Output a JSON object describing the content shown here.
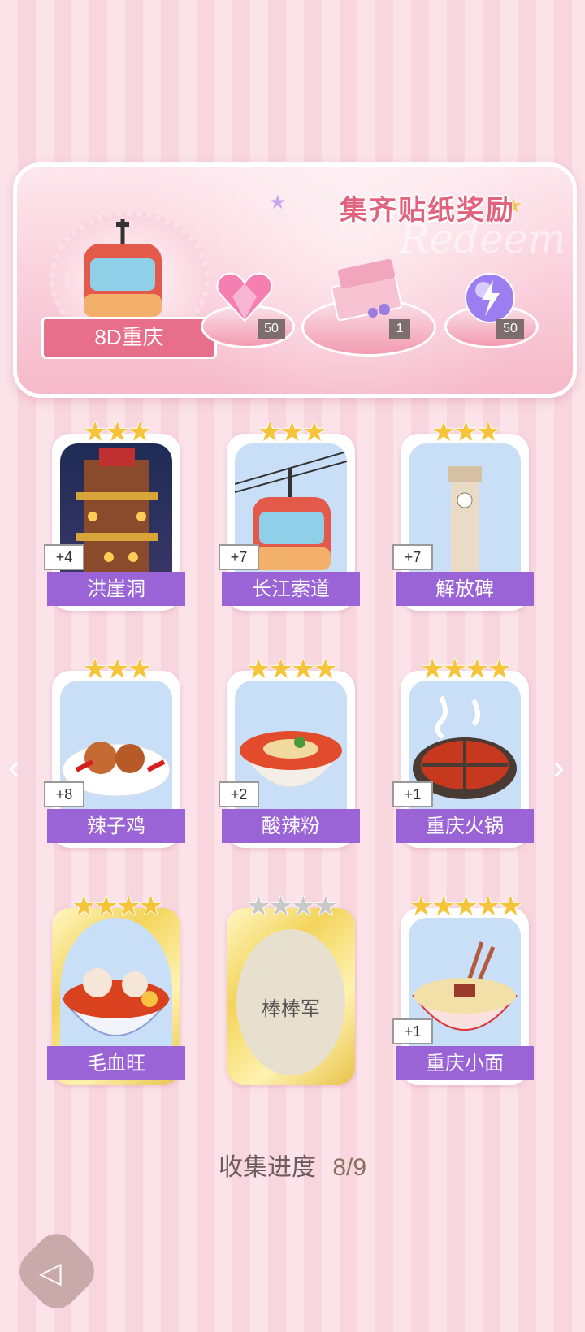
{
  "banner": {
    "title": "集齐贴纸奖励",
    "deco_word": "Redeem",
    "region_label": "8D重庆",
    "rewards": [
      {
        "icon": "pink-heart-gem-icon",
        "count": "50"
      },
      {
        "icon": "gift-box-icon",
        "count": "1"
      },
      {
        "icon": "purple-energy-orb-icon",
        "count": "50"
      }
    ]
  },
  "cards": [
    {
      "name": "洪崖洞",
      "stars": "★★★",
      "bonus": "+4",
      "icon": "hongyadong-building-icon"
    },
    {
      "name": "长江索道",
      "stars": "★★★",
      "bonus": "+7",
      "icon": "cable-car-icon"
    },
    {
      "name": "解放碑",
      "stars": "★★★",
      "bonus": "+7",
      "icon": "clock-tower-icon"
    },
    {
      "name": "辣子鸡",
      "stars": "★★★",
      "bonus": "+8",
      "icon": "spicy-chicken-icon"
    },
    {
      "name": "酸辣粉",
      "stars": "★★★★",
      "bonus": "+2",
      "icon": "noodle-bowl-icon"
    },
    {
      "name": "重庆火锅",
      "stars": "★★★★",
      "bonus": "+1",
      "icon": "hotpot-icon"
    },
    {
      "name": "毛血旺",
      "stars": "★★★★",
      "bonus": "",
      "icon": "maoxuewang-bowl-icon"
    },
    {
      "name": "棒棒军",
      "stars": "★★★★",
      "bonus": "",
      "icon": "locked-card"
    },
    {
      "name": "重庆小面",
      "stars": "★★★★★",
      "bonus": "+1",
      "icon": "chongqing-noodles-icon"
    }
  ],
  "progress": {
    "label": "收集进度",
    "value": "8/9"
  },
  "nav": {
    "prev": "‹",
    "next": "›",
    "back": "◁"
  },
  "colors": {
    "accent": "#9a63d6",
    "title": "#e0647e",
    "ribbon": "#e76f8b"
  }
}
